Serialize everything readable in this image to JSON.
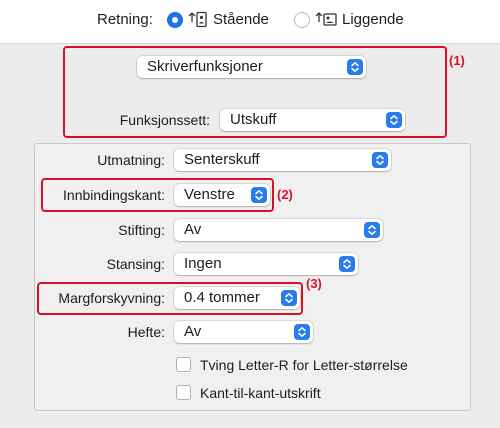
{
  "orientation": {
    "label": "Retning:",
    "portrait_label": "Stående",
    "landscape_label": "Liggende",
    "selected": "portrait"
  },
  "section_popup": {
    "value": "Skriverfunksjoner"
  },
  "feature_set": {
    "label": "Funksjonssett:",
    "value": "Utskuff"
  },
  "settings": {
    "output": {
      "label": "Utmatning:",
      "value": "Senterskuff"
    },
    "binding_edge": {
      "label": "Innbindingskant:",
      "value": "Venstre"
    },
    "stapling": {
      "label": "Stifting:",
      "value": "Av"
    },
    "punching": {
      "label": "Stansing:",
      "value": "Ingen"
    },
    "margin_shift": {
      "label": "Margforskyvning:",
      "value": "0.4 tommer"
    },
    "booklet": {
      "label": "Hefte:",
      "value": "Av"
    },
    "force_letter_r": {
      "label": "Tving Letter-R for Letter-størrelse",
      "checked": false
    },
    "edge_to_edge": {
      "label": "Kant-til-kant-utskrift",
      "checked": false
    }
  },
  "callouts": {
    "one": "(1)",
    "two": "(2)",
    "three": "(3)"
  },
  "colors": {
    "accent": "#2a7af0",
    "callout": "#d8102a"
  },
  "icons": [
    "portrait-orientation-icon",
    "landscape-orientation-icon",
    "popup-chevron-icon"
  ]
}
